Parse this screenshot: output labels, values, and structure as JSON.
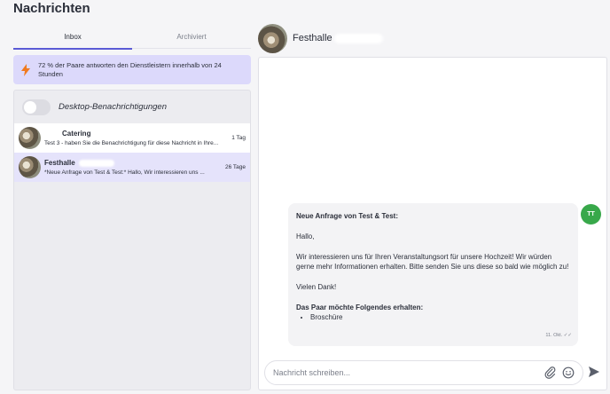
{
  "page": {
    "title": "Nachrichten"
  },
  "tabs": [
    {
      "label": "Inbox",
      "active": true
    },
    {
      "label": "Archiviert",
      "active": false
    }
  ],
  "info_banner": {
    "icon": "bolt-icon",
    "text": "72 % der Paare antworten den Dienstleistern innerhalb von 24 Stunden",
    "accent": "#f07a1f"
  },
  "notifications": {
    "label": "Desktop-Benachrichtigungen",
    "enabled": false
  },
  "conversations": [
    {
      "name": "Catering",
      "preview": "Test 3 - haben Sie die Benachrichtigung für diese Nachricht in Ihre...",
      "time": "1 Tag",
      "selected": false
    },
    {
      "name": "Festhalle",
      "preview": "*Neue Anfrage von Test & Test:* Hallo, Wir interessieren uns ...",
      "time": "26 Tage",
      "selected": true
    }
  ],
  "chat": {
    "title": "Festhalle",
    "user_initials": "TT",
    "message": {
      "heading": "Neue Anfrage von Test & Test:",
      "greeting": "Hallo,",
      "body": "Wir interessieren uns für Ihren Veranstaltungsort für unsere Hochzeit! Wir würden gerne mehr Informationen erhalten. Bitte senden Sie uns diese so bald wie möglich zu!",
      "thanks": "Vielen Dank!",
      "request_heading": "Das Paar möchte Folgendes erhalten:",
      "request_items": [
        "Broschüre"
      ],
      "timestamp": "11. Okt."
    },
    "composer_placeholder": "Nachricht schreiben..."
  },
  "colors": {
    "accent": "#5b5bd6",
    "banner_bg": "#dcd9fb",
    "avatar_green": "#38a84a"
  }
}
